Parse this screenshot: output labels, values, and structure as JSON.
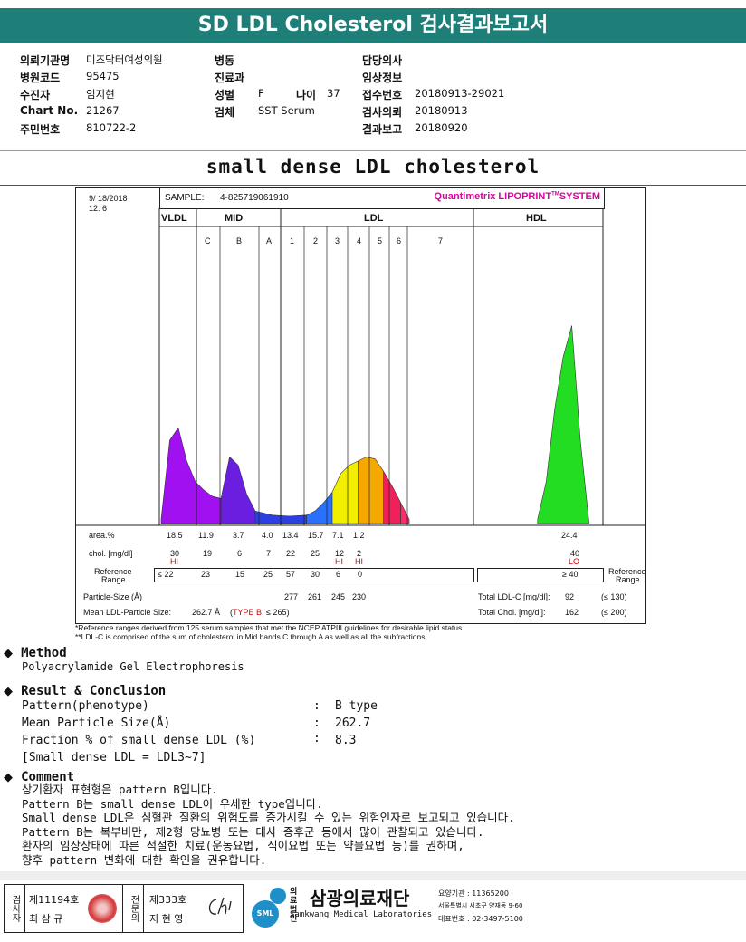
{
  "title": "SD LDL Cholesterol 검사결과보고서",
  "header": {
    "col1": [
      {
        "label": "의뢰기관명",
        "value": "미즈닥터여성의원"
      },
      {
        "label": "병원코드",
        "value": "95475"
      },
      {
        "label": "수진자",
        "value": "임지현"
      },
      {
        "label": "Chart No.",
        "value": "21267"
      },
      {
        "label": "주민번호",
        "value": "810722-2"
      }
    ],
    "col2": [
      {
        "label": "병동",
        "value": ""
      },
      {
        "label": "진료과",
        "value": ""
      },
      {
        "label": "성별",
        "value": "F"
      },
      {
        "label": "검체",
        "value": "SST Serum"
      }
    ],
    "age": {
      "label": "나이",
      "value": "37"
    },
    "col3": [
      {
        "label": "담당의사",
        "value": ""
      },
      {
        "label": "임상정보",
        "value": ""
      },
      {
        "label": "접수번호",
        "value": "20180913-29021"
      },
      {
        "label": "검사의뢰",
        "value": "20180913"
      },
      {
        "label": "결과보고",
        "value": "20180920"
      }
    ]
  },
  "subtitle": "small dense LDL cholesterol",
  "chart": {
    "date": "9/ 18/2018",
    "time": "12: 6",
    "sample_label": "SAMPLE:",
    "sample_id": "4-825719061910",
    "brand": "Quantimetrix LIPOPRINT",
    "brand_tm": "TM",
    "brand_suffix": "SYSTEM",
    "groups": {
      "vldl": "VLDL",
      "mid": "MID",
      "ldl": "LDL",
      "hdl": "HDL"
    },
    "bands": [
      "C",
      "B",
      "A",
      "1",
      "2",
      "3",
      "4",
      "5",
      "6",
      "7"
    ],
    "row_labels": {
      "area": "area.%",
      "chol": "chol. [mg/dl]",
      "ref1": "Reference",
      "ref2": "Range",
      "ref_right1": "Reference",
      "ref_right2": "Range",
      "psize": "Particle-Size (Å)",
      "mean": "Mean LDL-Particle Size:",
      "total_ldl": "Total LDL-C [mg/dl]:",
      "total_chol": "Total Chol. [mg/dl]:"
    },
    "area": [
      "18.5",
      "11.9",
      "3.7",
      "4.0",
      "13.4",
      "15.7",
      "7.1",
      "1.2",
      "24.4"
    ],
    "chol": [
      "30",
      "19",
      "6",
      "7",
      "22",
      "25",
      "12",
      "2",
      "40"
    ],
    "flags": {
      "vldl": "HI",
      "b3": "HI",
      "b4": "HI",
      "hdl": "LO"
    },
    "ref": [
      "≤ 22",
      "23",
      "15",
      "25",
      "57",
      "30",
      "6",
      "0",
      "≥ 40"
    ],
    "particle_size": [
      "277",
      "261",
      "245",
      "230"
    ],
    "mean_size_value": "262.7 Å",
    "mean_size_paren_open": "(",
    "mean_size_type": "TYPE B",
    "mean_size_rest": "; ≤ 265)",
    "total_ldl_value": "92",
    "total_ldl_ref": "(≤ 130)",
    "total_chol_value": "162",
    "total_chol_ref": "(≤ 200)"
  },
  "chart_data": {
    "type": "area",
    "title": "",
    "xlabel": "",
    "ylabel": "",
    "series": [
      {
        "name": "VLDL",
        "color": "#a010f0",
        "x": [
          0,
          1,
          2,
          3,
          4,
          5,
          6,
          7
        ],
        "y": [
          0.02,
          0.4,
          0.46,
          0.3,
          0.2,
          0.16,
          0.13,
          0.12
        ]
      },
      {
        "name": "MID C",
        "color": "#6a1ee0",
        "x": [
          7,
          8,
          9,
          10,
          11
        ],
        "y": [
          0.12,
          0.32,
          0.28,
          0.14,
          0.06
        ]
      },
      {
        "name": "MID B",
        "color": "#2a40e0",
        "x": [
          11,
          13,
          15,
          17
        ],
        "y": [
          0.06,
          0.04,
          0.035,
          0.04
        ]
      },
      {
        "name": "MID A",
        "color": "#2a70ff",
        "x": [
          17,
          18,
          19,
          20
        ],
        "y": [
          0.04,
          0.06,
          0.1,
          0.15
        ]
      },
      {
        "name": "LDL 1",
        "color": "#f2f000",
        "x": [
          20,
          21,
          22,
          23
        ],
        "y": [
          0.15,
          0.24,
          0.28,
          0.3
        ]
      },
      {
        "name": "LDL 2",
        "color": "#f5a800",
        "x": [
          23,
          24,
          25,
          26
        ],
        "y": [
          0.3,
          0.32,
          0.31,
          0.25
        ]
      },
      {
        "name": "LDL 3",
        "color": "#f0205a",
        "x": [
          26,
          27,
          28
        ],
        "y": [
          0.25,
          0.18,
          0.1
        ]
      },
      {
        "name": "LDL 4",
        "color": "#ff2a6a",
        "x": [
          28,
          29
        ],
        "y": [
          0.1,
          0.02
        ]
      },
      {
        "name": "HDL",
        "color": "#22dd22",
        "x": [
          44,
          45,
          46,
          47,
          48,
          49,
          50
        ],
        "y": [
          0.02,
          0.2,
          0.55,
          0.8,
          0.95,
          0.4,
          0.01
        ]
      }
    ]
  },
  "notes": [
    "*Reference ranges derived from 125 serum samples that met the NCEP ATPIII guidelines for desirable lipid status",
    "**LDL-C is comprised of the sum of cholesterol in Mid bands C through A as well as all the subfractions"
  ],
  "method": {
    "heading": "Method",
    "text": "Polyacrylamide Gel Electrophoresis"
  },
  "result": {
    "heading": "Result & Conclusion",
    "rows": [
      {
        "label": "Pattern(phenotype)",
        "sep": ":",
        "value": "B type"
      },
      {
        "label": "Mean Particle Size(Å)",
        "sep": ":",
        "value": "262.7"
      },
      {
        "label": "Fraction % of small dense LDL (%)",
        "sep": ":",
        "value": "8.3"
      }
    ],
    "note": "[Small dense LDL = LDL3~7]"
  },
  "comment": {
    "heading": "Comment",
    "lines": [
      "상기환자 표현형은 pattern B입니다.",
      "Pattern B는 small dense LDL이 우세한 type입니다.",
      "Small dense LDL은 심혈관 질환의 위험도를 증가시킬 수 있는 위험인자로 보고되고 있습니다.",
      "Pattern B는 복부비만, 제2형 당뇨병 또는 대사 증후군 등에서 많이 관찰되고 있습니다.",
      "환자의 임상상태에 따른 적절한 치료(운동요법, 식이요법 또는 약물요법 등)를 권하며,",
      "향후 pattern 변화에 대한 확인을 권유합니다."
    ]
  },
  "footer": {
    "tester_v": "검사자",
    "tester_no": "제11194호",
    "tester_name": "최 삼 규",
    "spec_v": "전문의",
    "spec_no": "제333호",
    "spec_name": "지 현 영",
    "org_type": "의료법인",
    "org_name": "삼광의료재단",
    "org_en": "Samkwang Medical Laboratories",
    "sml": "SML",
    "code": "요양기관 : 11365200",
    "address": "서울특별시 서초구 양재동 9-60",
    "phone": "대표번호 : 02-3497-5100",
    "brand_color": "#1e7f79"
  }
}
